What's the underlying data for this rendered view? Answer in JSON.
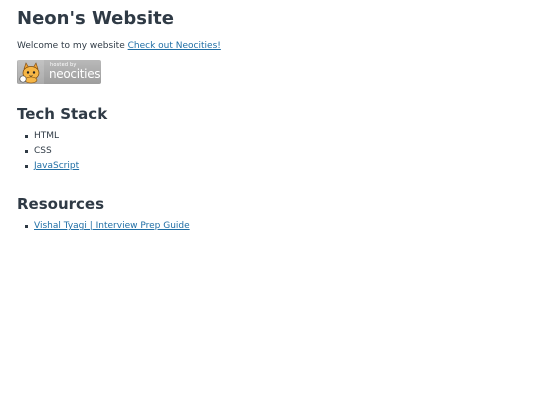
{
  "header": {
    "title": "Neon's Website"
  },
  "intro": {
    "text": "Welcome to my website",
    "link_label": "Check out Neocities!"
  },
  "badge": {
    "hosted_by": "hosted by",
    "brand": "neocities",
    "icon": "neocities-cat-icon"
  },
  "tech_stack": {
    "heading": "Tech Stack",
    "items": [
      {
        "label": "HTML",
        "link": false
      },
      {
        "label": "CSS",
        "link": false
      },
      {
        "label": "JavaScript",
        "link": true
      }
    ]
  },
  "resources": {
    "heading": "Resources",
    "items": [
      {
        "label": "Vishal Tyagi | Interview Prep Guide",
        "link": true
      }
    ]
  },
  "colors": {
    "text": "#2f3a45",
    "link": "#1f6ea5",
    "badge_bg": "#a8a8a8"
  }
}
